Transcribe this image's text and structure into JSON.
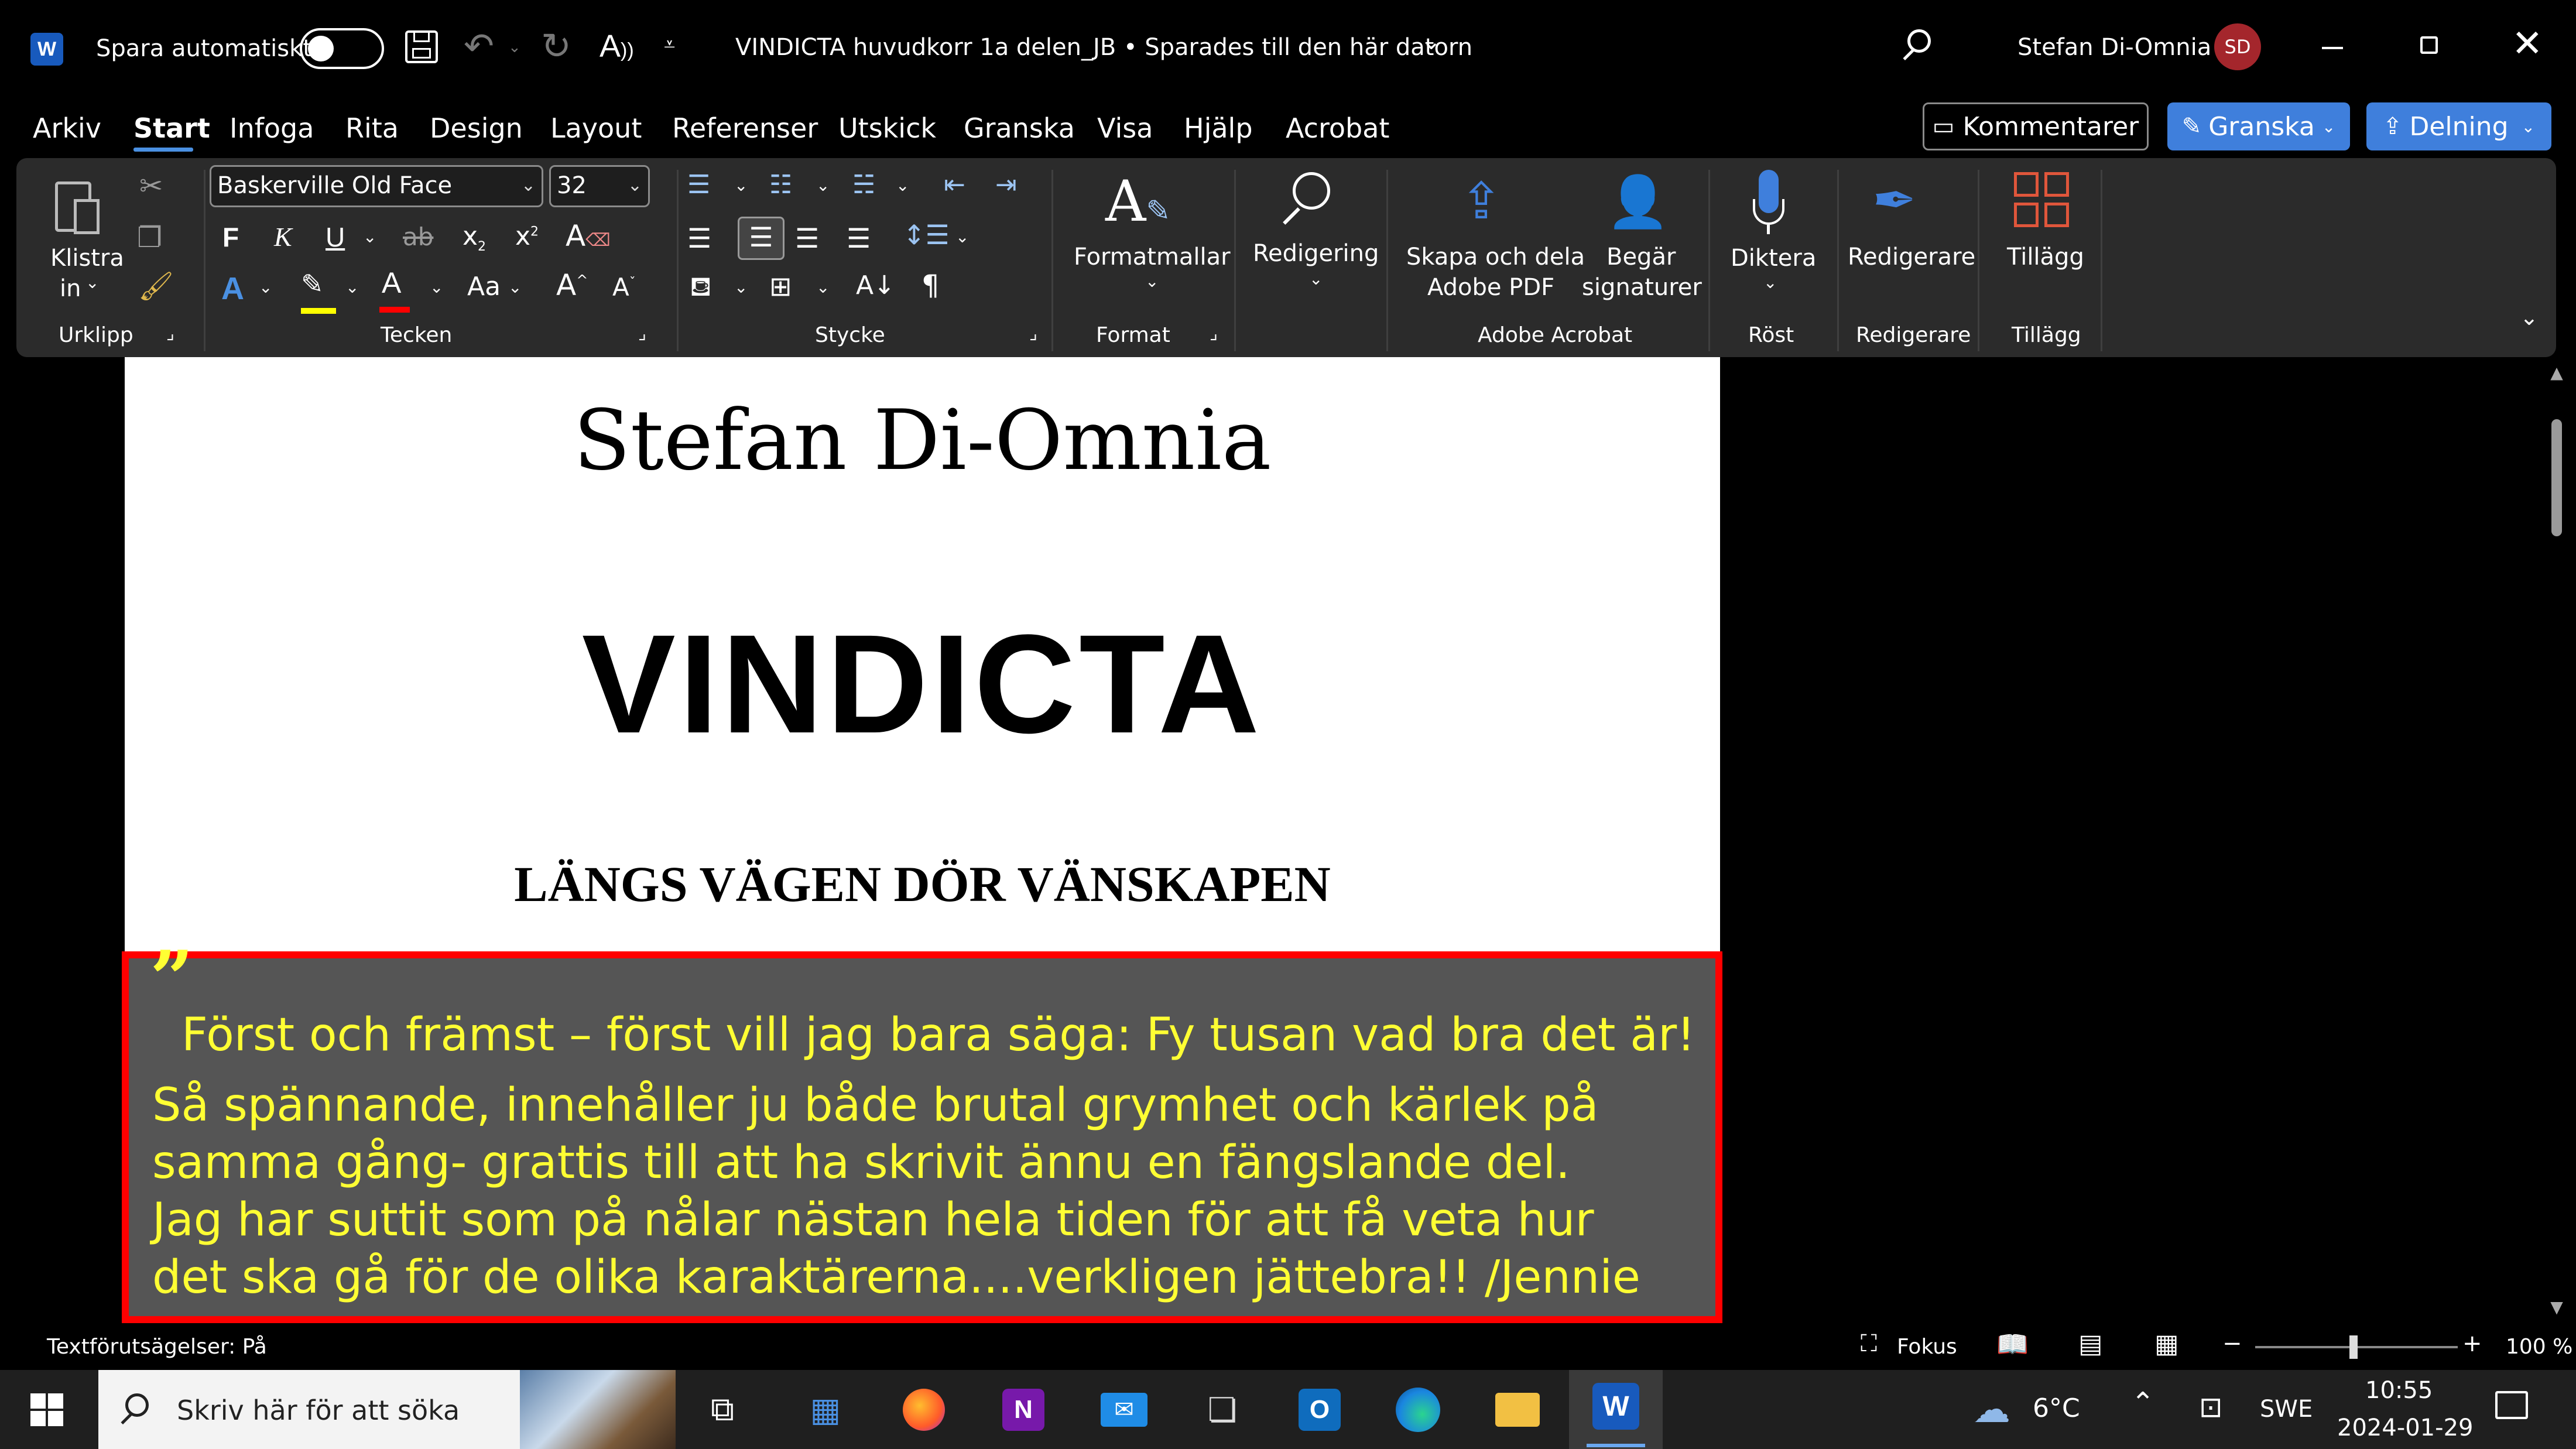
{
  "titlebar": {
    "app_icon": "word-icon",
    "autosave_label": "Spara automatiskt",
    "doc_title": "VINDICTA huvudkorr 1a delen_JB • Sparades till den här datorn",
    "user_name": "Stefan Di-Omnia",
    "user_initials": "SD",
    "accent": "#a4262c"
  },
  "menu": {
    "items": [
      "Arkiv",
      "Start",
      "Infoga",
      "Rita",
      "Design",
      "Layout",
      "Referenser",
      "Utskick",
      "Granska",
      "Visa",
      "Hjälp",
      "Acrobat"
    ],
    "active": "Start",
    "comments": "Kommentarer",
    "review": "Granska",
    "share": "Delning"
  },
  "ribbon": {
    "paste_label_1": "Klistra",
    "paste_label_2": "in",
    "group_clipboard": "Urklipp",
    "font_name": "Baskerville Old Face",
    "font_size": "32",
    "bold": "F",
    "italic": "K",
    "underline": "U",
    "strike": "ab",
    "subscript": "x",
    "superscript": "x",
    "case": "Aa",
    "grow": "A",
    "shrink": "A",
    "group_font": "Tecken",
    "group_paragraph": "Stycke",
    "styles_label": "Formatmallar",
    "group_styles": "Format",
    "editing_label": "Redigering",
    "create_pdf_1": "Skapa och dela",
    "create_pdf_2": "Adobe PDF",
    "request_sig_1": "Begär",
    "request_sig_2": "signaturer",
    "group_acrobat": "Adobe Acrobat",
    "dictate_label": "Diktera",
    "group_voice": "Röst",
    "editor_label": "Redigerare",
    "group_editor": "Redigerare",
    "addins_label": "Tillägg",
    "group_addins": "Tillägg"
  },
  "document": {
    "author": "Stefan Di-Omnia",
    "title": "VINDICTA",
    "subtitle": "LÄNGS VÄGEN DÖR VÄNSKAPEN",
    "quote_mark": "”",
    "quote_lines": [
      "Först och främst – först vill jag bara säga: Fy tusan vad bra det är!",
      "Så spännande, innehåller ju både brutal grymhet och kärlek på",
      "samma gång- grattis till att ha skrivit ännu en fängslande del.",
      "Jag har suttit som på nålar nästan hela tiden för att få veta hur",
      "det ska gå för de olika karaktärerna....verkligen jättebra!! /Jennie"
    ],
    "quote_color": "#ffff33",
    "quote_border": "#ff0000"
  },
  "statusbar": {
    "predictions": "Textförutsägelser: På",
    "focus": "Fokus",
    "zoom": "100 %"
  },
  "taskbar": {
    "search_placeholder": "Skriv här för att söka",
    "weather": "6°C",
    "language": "SWE",
    "time": "10:55",
    "date": "2024-01-29"
  }
}
